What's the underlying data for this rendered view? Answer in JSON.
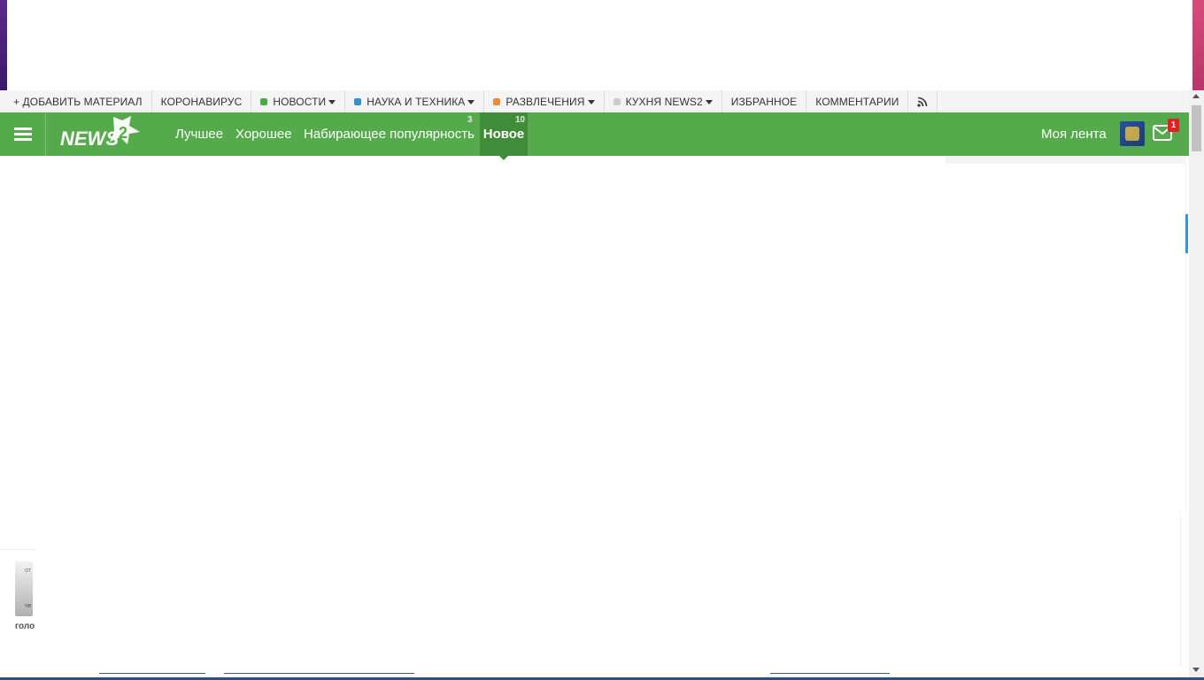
{
  "categories": {
    "add_material": "+ ДОБАВИТЬ МАТЕРИАЛ",
    "coronavirus": "КОРОНАВИРУС",
    "news": "НОВОСТИ",
    "science": "НАУКА И ТЕХНИКА",
    "entertainment": "РАЗВЛЕЧЕНИЯ",
    "kitchen": "КУХНЯ NEWS2",
    "favorites": "ИЗБРАННОЕ",
    "comments": "КОММЕНТАРИИ",
    "colors": {
      "news": "#4caa40",
      "science": "#3a8fc8",
      "entertainment": "#f08a3a",
      "kitchen": "#cccccc"
    }
  },
  "header": {
    "logo_text": "NEWS",
    "logo_number": "2",
    "nav": {
      "best": "Лучшее",
      "good": "Хорошее",
      "popular": "Набирающее популярность",
      "popular_count": "3",
      "new": "Новое",
      "new_count": "10"
    },
    "my_feed": "Моя лента",
    "mail_badge": "1",
    "accent_color": "#55aa4c",
    "active_color": "#418c39"
  },
  "left_fragment": {
    "thumb_top": "от",
    "thumb_bottom": "че",
    "word": "голо"
  }
}
